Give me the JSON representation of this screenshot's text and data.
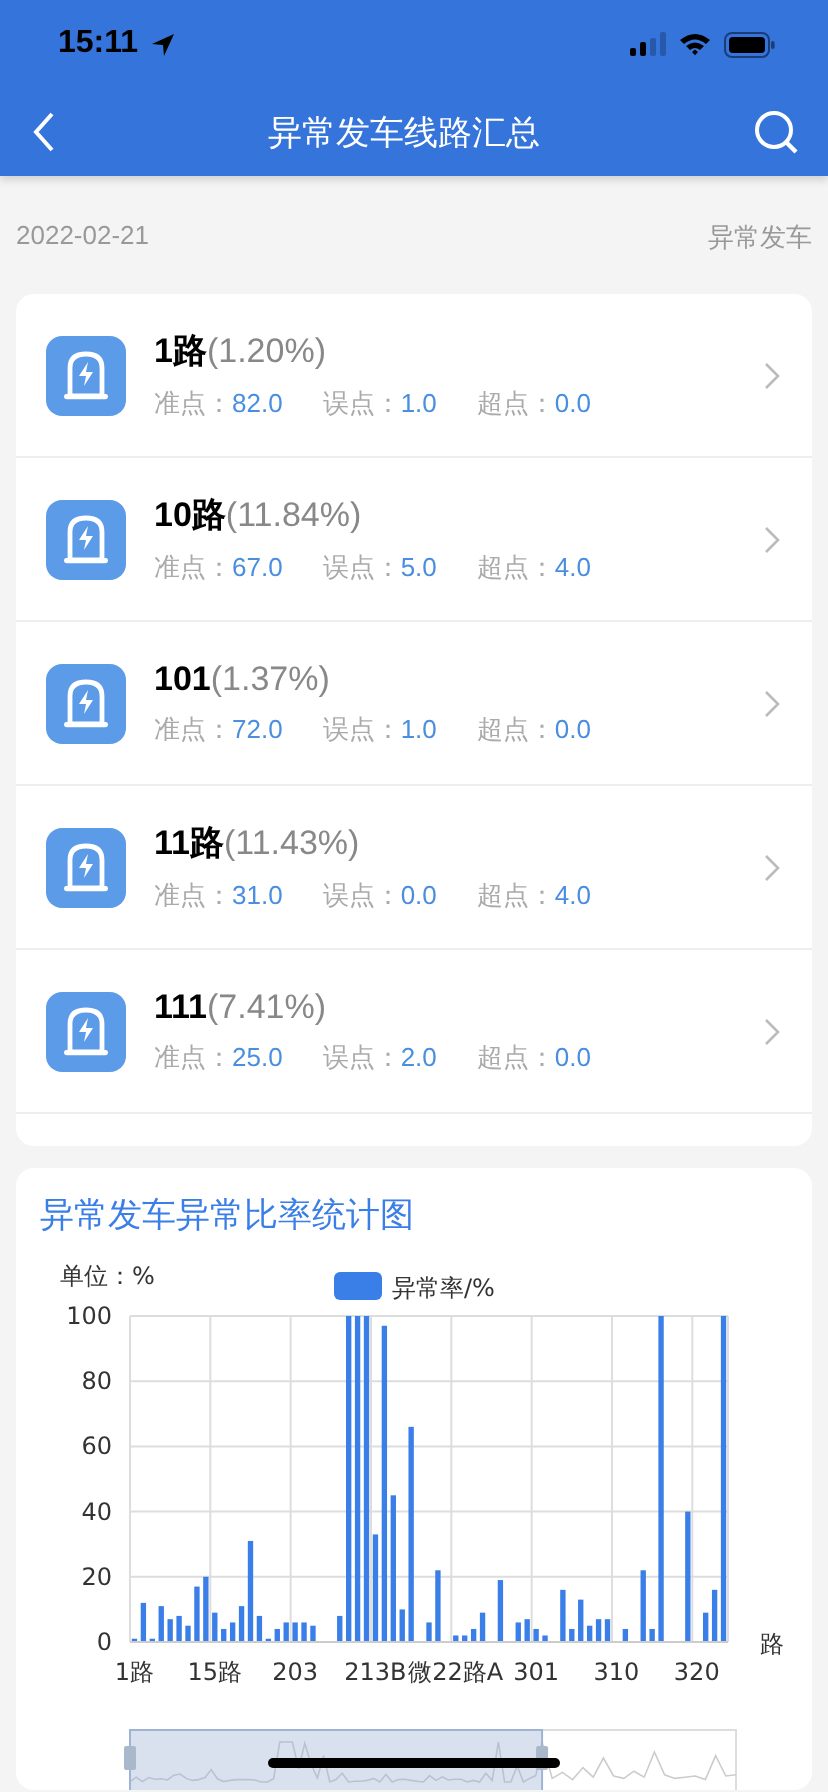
{
  "status_bar": {
    "time": "15:11"
  },
  "nav": {
    "title": "异常发车线路汇总"
  },
  "header": {
    "date": "2022-02-21",
    "type": "异常发车"
  },
  "routes": [
    {
      "name": "1路",
      "percent": "(1.20%)",
      "stats": [
        {
          "label": "准点：",
          "value": "82.0"
        },
        {
          "label": "误点：",
          "value": "1.0"
        },
        {
          "label": "超点：",
          "value": "0.0"
        }
      ]
    },
    {
      "name": "10路",
      "percent": "(11.84%)",
      "stats": [
        {
          "label": "准点：",
          "value": "67.0"
        },
        {
          "label": "误点：",
          "value": "5.0"
        },
        {
          "label": "超点：",
          "value": "4.0"
        }
      ]
    },
    {
      "name": "101",
      "percent": "(1.37%)",
      "stats": [
        {
          "label": "准点：",
          "value": "72.0"
        },
        {
          "label": "误点：",
          "value": "1.0"
        },
        {
          "label": "超点：",
          "value": "0.0"
        }
      ]
    },
    {
      "name": "11路",
      "percent": "(11.43%)",
      "stats": [
        {
          "label": "准点：",
          "value": "31.0"
        },
        {
          "label": "误点：",
          "value": "0.0"
        },
        {
          "label": "超点：",
          "value": "4.0"
        }
      ]
    },
    {
      "name": "111",
      "percent": "(7.41%)",
      "stats": [
        {
          "label": "准点：",
          "value": "25.0"
        },
        {
          "label": "误点：",
          "value": "2.0"
        },
        {
          "label": "超点：",
          "value": "0.0"
        }
      ]
    }
  ],
  "chart_card": {
    "title": "异常发车异常比率统计图",
    "chart_data": {
      "type": "bar",
      "ylabel": "单位：%",
      "xlabel": "路",
      "ylim": [
        0,
        100
      ],
      "yticks": [
        0,
        20,
        40,
        60,
        80,
        100
      ],
      "grid": true,
      "categories": [
        "1路",
        null,
        null,
        null,
        null,
        null,
        null,
        null,
        null,
        "15路",
        null,
        null,
        null,
        null,
        null,
        null,
        null,
        null,
        "203",
        null,
        null,
        null,
        null,
        null,
        null,
        null,
        null,
        "213B",
        null,
        null,
        null,
        null,
        null,
        null,
        null,
        null,
        "微22路A",
        null,
        null,
        null,
        null,
        null,
        null,
        null,
        null,
        "301",
        null,
        null,
        null,
        null,
        null,
        null,
        null,
        null,
        "310",
        null,
        null,
        null,
        null,
        null,
        null,
        null,
        null,
        "320",
        null,
        null,
        null
      ],
      "series": [
        {
          "name": "异常率/%",
          "color": "#3a7ee8",
          "values": [
            1,
            12,
            1,
            11,
            7,
            8,
            5,
            17,
            20,
            9,
            4,
            6,
            11,
            31,
            8,
            1,
            4,
            6,
            6,
            6,
            5,
            0,
            0,
            8,
            100,
            100,
            100,
            33,
            97,
            45,
            10,
            66,
            0,
            6,
            22,
            0,
            2,
            2,
            4,
            9,
            0,
            19,
            0,
            6,
            7,
            4,
            2,
            0,
            16,
            4,
            13,
            5,
            7,
            7,
            0,
            4,
            0,
            22,
            4,
            100,
            0,
            0,
            40,
            0,
            9,
            16,
            100
          ]
        }
      ]
    },
    "zoom_slider": {
      "level": 0.68
    }
  }
}
